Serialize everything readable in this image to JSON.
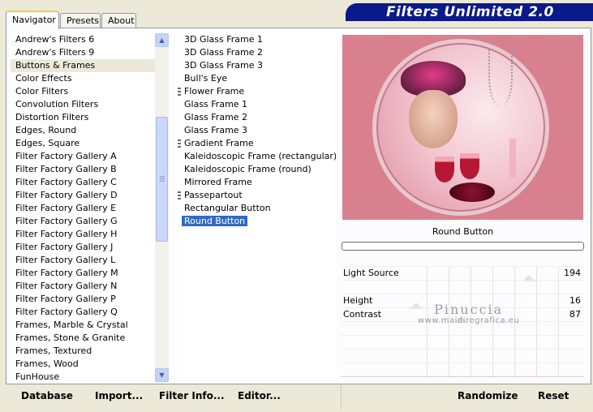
{
  "tabs": [
    {
      "label": "Navigator",
      "active": true
    },
    {
      "label": "Presets",
      "active": false
    },
    {
      "label": "About",
      "active": false
    }
  ],
  "app_title": "Filters Unlimited 2.0",
  "categories": [
    {
      "label": "Andrew's Filters 6"
    },
    {
      "label": "Andrew's Filters 9"
    },
    {
      "label": "Buttons & Frames",
      "highlight": true
    },
    {
      "label": "Color Effects"
    },
    {
      "label": "Color Filters"
    },
    {
      "label": "Convolution Filters"
    },
    {
      "label": "Distortion Filters"
    },
    {
      "label": "Edges, Round"
    },
    {
      "label": "Edges, Square"
    },
    {
      "label": "Filter Factory Gallery A"
    },
    {
      "label": "Filter Factory Gallery B"
    },
    {
      "label": "Filter Factory Gallery C"
    },
    {
      "label": "Filter Factory Gallery D"
    },
    {
      "label": "Filter Factory Gallery E"
    },
    {
      "label": "Filter Factory Gallery G"
    },
    {
      "label": "Filter Factory Gallery H"
    },
    {
      "label": "Filter Factory Gallery J"
    },
    {
      "label": "Filter Factory Gallery L"
    },
    {
      "label": "Filter Factory Gallery M"
    },
    {
      "label": "Filter Factory Gallery N"
    },
    {
      "label": "Filter Factory Gallery P"
    },
    {
      "label": "Filter Factory Gallery Q"
    },
    {
      "label": "Frames, Marble & Crystal"
    },
    {
      "label": "Frames, Stone & Granite"
    },
    {
      "label": "Frames, Textured"
    },
    {
      "label": "Frames, Wood"
    },
    {
      "label": "FunHouse"
    }
  ],
  "filters": [
    {
      "label": "3D Glass Frame 1"
    },
    {
      "label": "3D Glass Frame 2"
    },
    {
      "label": "3D Glass Frame 3"
    },
    {
      "label": "Bull's Eye"
    },
    {
      "label": "Flower Frame",
      "marker": true
    },
    {
      "label": "Glass Frame 1"
    },
    {
      "label": "Glass Frame 2"
    },
    {
      "label": "Glass Frame 3"
    },
    {
      "label": "Gradient Frame",
      "marker": true
    },
    {
      "label": "Kaleidoscopic Frame (rectangular)"
    },
    {
      "label": "Kaleidoscopic Frame (round)"
    },
    {
      "label": "Mirrored Frame"
    },
    {
      "label": "Passepartout",
      "marker": true
    },
    {
      "label": "Rectangular Button"
    },
    {
      "label": "Round Button",
      "selected": true
    }
  ],
  "selected_filter_name": "Round Button",
  "parameters": [
    {
      "name": "Light Source",
      "value": "194",
      "level": 194
    },
    {
      "name": "",
      "value": ""
    },
    {
      "name": "Height",
      "value": "16",
      "level": 16
    },
    {
      "name": "Contrast",
      "value": "87",
      "level": 87
    },
    {
      "name": "",
      "value": ""
    },
    {
      "name": "",
      "value": ""
    },
    {
      "name": "",
      "value": ""
    },
    {
      "name": "",
      "value": ""
    }
  ],
  "watermark": {
    "line1": "Pinuccia",
    "line2": "www.maidiregrafica.eu"
  },
  "buttons": {
    "database": "Database",
    "import": "Import...",
    "filter_info": "Filter Info...",
    "editor": "Editor...",
    "randomize": "Randomize",
    "reset": "Reset"
  },
  "icons": {
    "scroll_up": "chevron-up-icon",
    "scroll_down": "chevron-down-icon"
  },
  "colors": {
    "title_bg": "#0a1a8a",
    "selection": "#316ac5",
    "preview_bg": "#d9808f"
  }
}
